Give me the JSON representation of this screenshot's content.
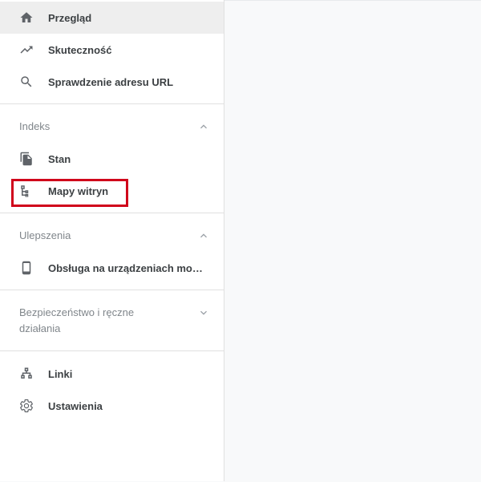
{
  "sidebar": {
    "items": [
      {
        "label": "Przegląd",
        "icon": "home-icon"
      },
      {
        "label": "Skuteczność",
        "icon": "trending-up-icon"
      },
      {
        "label": "Sprawdzenie adresu URL",
        "icon": "search-icon"
      }
    ],
    "sections": {
      "index": {
        "title": "Indeks",
        "expanded": true,
        "items": [
          {
            "label": "Stan",
            "icon": "copy-pages-icon"
          },
          {
            "label": "Mapy witryn",
            "icon": "sitemap-icon"
          }
        ]
      },
      "enhancements": {
        "title": "Ulepszenia",
        "expanded": true,
        "items": [
          {
            "label": "Obsługa na urządzeniach mobil…",
            "icon": "smartphone-icon"
          }
        ]
      },
      "security": {
        "title_line1": "Bezpieczeństwo i ręczne",
        "title_line2": "działania",
        "expanded": false
      }
    },
    "bottom_items": [
      {
        "label": "Linki",
        "icon": "links-icon"
      },
      {
        "label": "Ustawienia",
        "icon": "gear-icon"
      }
    ]
  },
  "colors": {
    "highlight": "#d0021b",
    "active_bg": "#eeeeee",
    "icon": "#5f6368"
  }
}
